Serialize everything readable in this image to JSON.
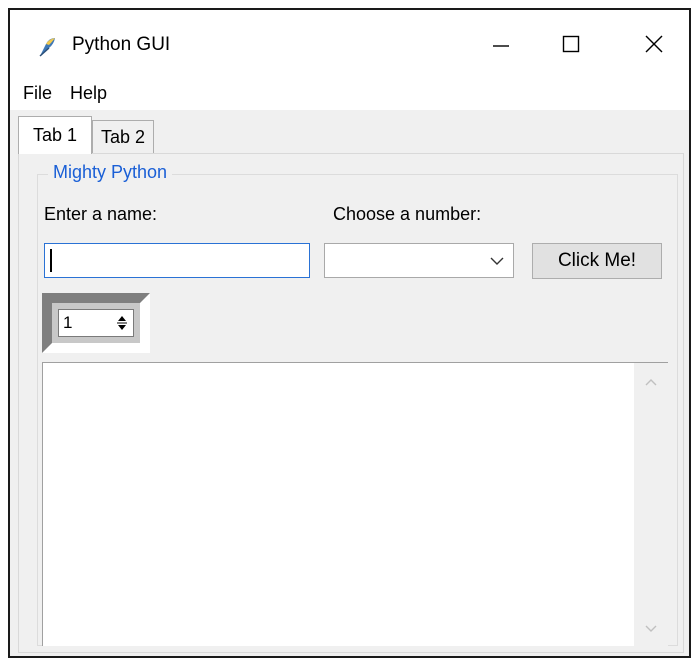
{
  "window": {
    "title": "Python GUI",
    "icon": "python-feather-icon"
  },
  "titlebar_buttons": {
    "minimize_icon": "minimize-icon",
    "maximize_icon": "maximize-icon",
    "close_icon": "close-icon"
  },
  "menubar": {
    "items": [
      {
        "label": "File"
      },
      {
        "label": "Help"
      }
    ]
  },
  "tabs": [
    {
      "label": "Tab 1",
      "selected": true
    },
    {
      "label": "Tab 2",
      "selected": false
    }
  ],
  "groupbox": {
    "title": "Mighty Python",
    "title_color": "#1a5fd6"
  },
  "form": {
    "name_label": "Enter a name:",
    "name_value": "",
    "number_label": "Choose a number:",
    "number_value": "",
    "button_label": "Click Me!"
  },
  "spinbox": {
    "value": "1"
  },
  "scrolled_text": {
    "content": ""
  },
  "colors": {
    "focus_border": "#2a72d5",
    "client_bg": "#f0f0f0"
  }
}
